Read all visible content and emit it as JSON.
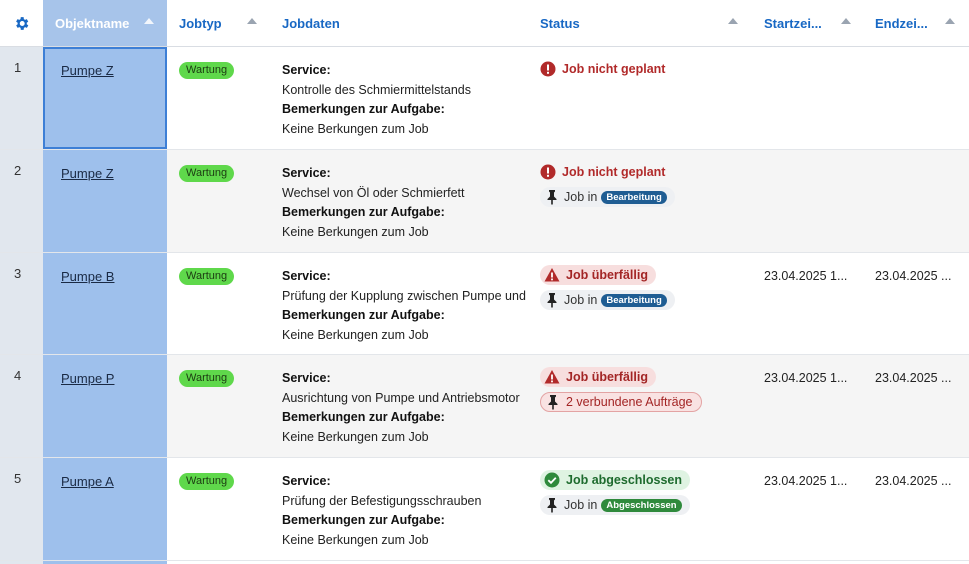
{
  "header": {
    "objektname": "Objektname",
    "jobtyp": "Jobtyp",
    "jobdaten": "Jobdaten",
    "status": "Status",
    "startzeit": "Startzei...",
    "endzeit": "Endzei..."
  },
  "rows": [
    {
      "num": "1",
      "objekt": "Pumpe Z",
      "jobtyp": "Wartung",
      "service_label": "Service:",
      "service": "Kontrolle des Schmiermittelstands",
      "bem_label": "Bemerkungen zur Aufgabe:",
      "bem": "Keine Berkungen zum Job",
      "status1": "Job nicht geplant",
      "status2": "",
      "status2_badge": "",
      "start": "",
      "end": ""
    },
    {
      "num": "2",
      "objekt": "Pumpe Z",
      "jobtyp": "Wartung",
      "service_label": "Service:",
      "service": "Wechsel von Öl oder Schmierfett",
      "bem_label": "Bemerkungen zur Aufgabe:",
      "bem": "Keine Berkungen zum Job",
      "status1": "Job nicht geplant",
      "status2": "Job in",
      "status2_badge": "Bearbeitung",
      "start": "",
      "end": ""
    },
    {
      "num": "3",
      "objekt": "Pumpe B",
      "jobtyp": "Wartung",
      "service_label": "Service:",
      "service": "Prüfung der Kupplung zwischen Pumpe und",
      "bem_label": "Bemerkungen zur Aufgabe:",
      "bem": "Keine Berkungen zum Job",
      "status1": "Job überfällig",
      "status2": "Job in",
      "status2_badge": "Bearbeitung",
      "start": "23.04.2025 1...",
      "end": "23.04.2025 ..."
    },
    {
      "num": "4",
      "objekt": "Pumpe P",
      "jobtyp": "Wartung",
      "service_label": "Service:",
      "service": "Ausrichtung von Pumpe und Antriebsmotor",
      "bem_label": "Bemerkungen zur Aufgabe:",
      "bem": "Keine Berkungen zum Job",
      "status1": "Job überfällig",
      "status2": "2 verbundene Aufträge",
      "status2_badge": "",
      "start": "23.04.2025 1...",
      "end": "23.04.2025 ..."
    },
    {
      "num": "5",
      "objekt": "Pumpe A",
      "jobtyp": "Wartung",
      "service_label": "Service:",
      "service": "Prüfung der Befestigungsschrauben",
      "bem_label": "Bemerkungen zur Aufgabe:",
      "bem": "Keine Berkungen zum Job",
      "status1": "Job abgeschlossen",
      "status2": "Job in",
      "status2_badge": "Abgeschlossen",
      "start": "23.04.2025 1...",
      "end": "23.04.2025 ..."
    }
  ],
  "colors": {
    "accent": "#1868c4",
    "selection": "#9ec0ec",
    "badge_green": "#5fd84b",
    "error": "#b12a2a"
  },
  "icons": {
    "settings": "gear-icon",
    "error": "error-circle-icon",
    "warning": "warning-triangle-icon",
    "pin": "pin-icon",
    "success": "check-circle-icon"
  }
}
